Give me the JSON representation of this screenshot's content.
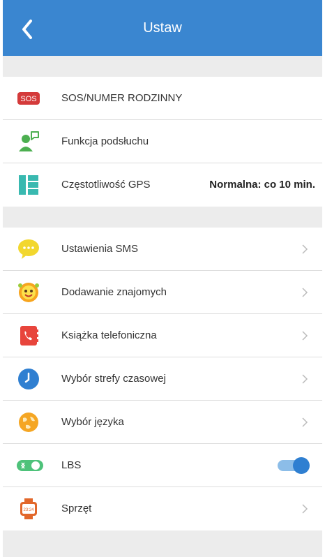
{
  "header": {
    "title": "Ustaw",
    "back_icon": "chevron-left-icon"
  },
  "colors": {
    "header": "#3a86d0",
    "accent": "#2f7fd1"
  },
  "section1": [
    {
      "label": "SOS/NUMER RODZINNY",
      "icon": "sos-icon"
    },
    {
      "label": "Funkcja podsłuchu",
      "icon": "listen-icon"
    },
    {
      "label": "Częstotliwość GPS",
      "icon": "gps-list-icon",
      "value": "Normalna: co 10 min."
    }
  ],
  "section2": [
    {
      "label": "Ustawienia SMS",
      "icon": "sms-icon"
    },
    {
      "label": "Dodawanie znajomych",
      "icon": "friend-icon"
    },
    {
      "label": "Książka telefoniczna",
      "icon": "phonebook-icon"
    },
    {
      "label": "Wybór strefy czasowej",
      "icon": "clock-icon"
    },
    {
      "label": "Wybór języka",
      "icon": "globe-icon"
    },
    {
      "label": "LBS",
      "icon": "lbs-toggle-icon",
      "toggle_on": true
    },
    {
      "label": "Sprzęt",
      "icon": "watch-icon"
    }
  ],
  "sos_badge": "SOS",
  "watch_time": "23:24"
}
